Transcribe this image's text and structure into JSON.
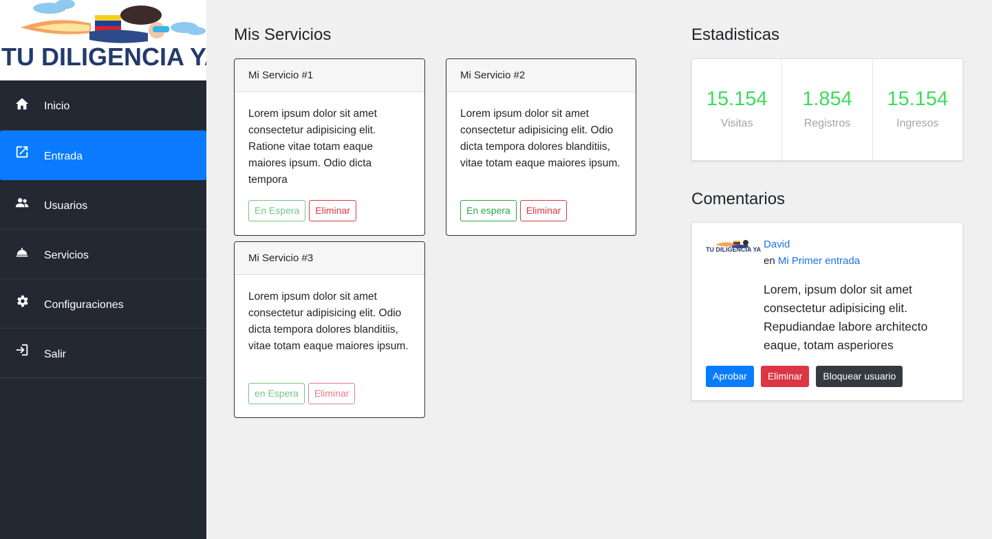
{
  "sidebar": {
    "logo_text": "TU DILIGENCIA YA",
    "items": [
      {
        "label": "Inicio",
        "icon": "home-icon"
      },
      {
        "label": "Entrada",
        "icon": "external-link-icon",
        "active": true
      },
      {
        "label": "Usuarios",
        "icon": "users-icon"
      },
      {
        "label": "Servicios",
        "icon": "service-bell-icon"
      },
      {
        "label": "Configuraciones",
        "icon": "gear-icon"
      },
      {
        "label": "Salir",
        "icon": "sign-in-icon"
      }
    ]
  },
  "services": {
    "title": "Mis Servicios",
    "cards": [
      {
        "title": "Mi Servicio #1",
        "body": "Lorem ipsum dolor sit amet consectetur adipisicing elit. Ratione vitae totam eaque maiores ipsum. Odio dicta tempora",
        "status_label": "En Espera",
        "delete_label": "Eliminar"
      },
      {
        "title": "Mi Servicio #2",
        "body": "Lorem ipsum dolor sit amet consectetur adipisicing elit. Odio dicta tempora dolores blanditiis, vitae totam eaque maiores ipsum.",
        "status_label": "En espera",
        "delete_label": "Eliminar"
      },
      {
        "title": "Mi Servicio #3",
        "body": "Lorem ipsum dolor sit amet consectetur adipisicing elit. Odio dicta tempora dolores blanditiis, vitae totam eaque maiores ipsum.",
        "status_label": "en Espera",
        "delete_label": "Eliminar"
      }
    ]
  },
  "stats": {
    "title": "Estadisticas",
    "items": [
      {
        "value": "15.154",
        "label": "Visitas"
      },
      {
        "value": "1.854",
        "label": "Registros"
      },
      {
        "value": "15.154",
        "label": "Ingresos"
      }
    ]
  },
  "comments": {
    "title": "Comentarios",
    "author": "David",
    "in_label": "en",
    "post": "Mi Primer entrada",
    "text": "Lorem, ipsum dolor sit amet consectetur adipisicing elit. Repudiandae labore architecto eaque, totam asperiores",
    "avatar_text": "TU DILIGENCIA YA",
    "approve_label": "Aprobar",
    "delete_label": "Eliminar",
    "block_label": "Bloquear usuario"
  },
  "colors": {
    "sidebar_bg": "#232833",
    "active_blue": "#0a7bff",
    "stat_green": "#3ddc5c",
    "danger": "#dc3545",
    "success": "#28a745",
    "dark": "#343a40"
  }
}
